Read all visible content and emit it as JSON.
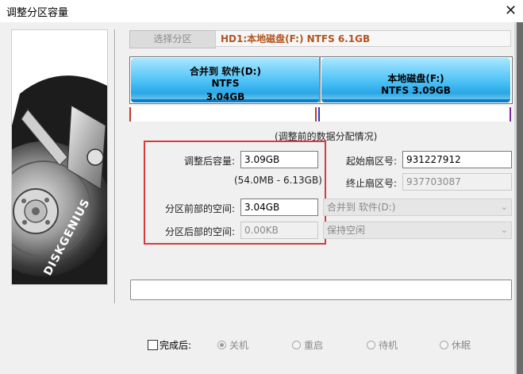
{
  "window": {
    "title": "调整分区容量",
    "close_glyph": "✕"
  },
  "logo": {
    "brand": "DISKGENIUS"
  },
  "toolbar": {
    "select_partition_label": "选择分区",
    "disk_info": "HD1:本地磁盘(F:) NTFS 6.1GB"
  },
  "partitions": [
    {
      "line1": "合并到 软件(D:)",
      "line2": "NTFS",
      "line3": "3.04GB"
    },
    {
      "line1": "本地磁盘(F:)",
      "line2": "NTFS 3.09GB"
    }
  ],
  "caption": "(调整前的数据分配情况)",
  "form": {
    "new_size_label": "调整后容量:",
    "new_size_value": "3.09GB",
    "range_text": "(54.0MB - 6.13GB)",
    "space_before_label": "分区前部的空间:",
    "space_before_value": "3.04GB",
    "space_after_label": "分区后部的空间:",
    "space_after_value": "0.00KB",
    "start_sector_label": "起始扇区号:",
    "start_sector_value": "931227912",
    "end_sector_label": "终止扇区号:",
    "end_sector_value": "937703087",
    "before_action": "合并到 软件(D:)",
    "after_action": "保持空闲"
  },
  "completion": {
    "checkbox_label": "完成后:",
    "options": [
      "关机",
      "重启",
      "待机",
      "休眠"
    ],
    "selected_index": 0
  },
  "colors": {
    "partition_fill": "#4fc3f7",
    "disk_info_text": "#b3541e",
    "highlight_box": "#d63a3a"
  }
}
